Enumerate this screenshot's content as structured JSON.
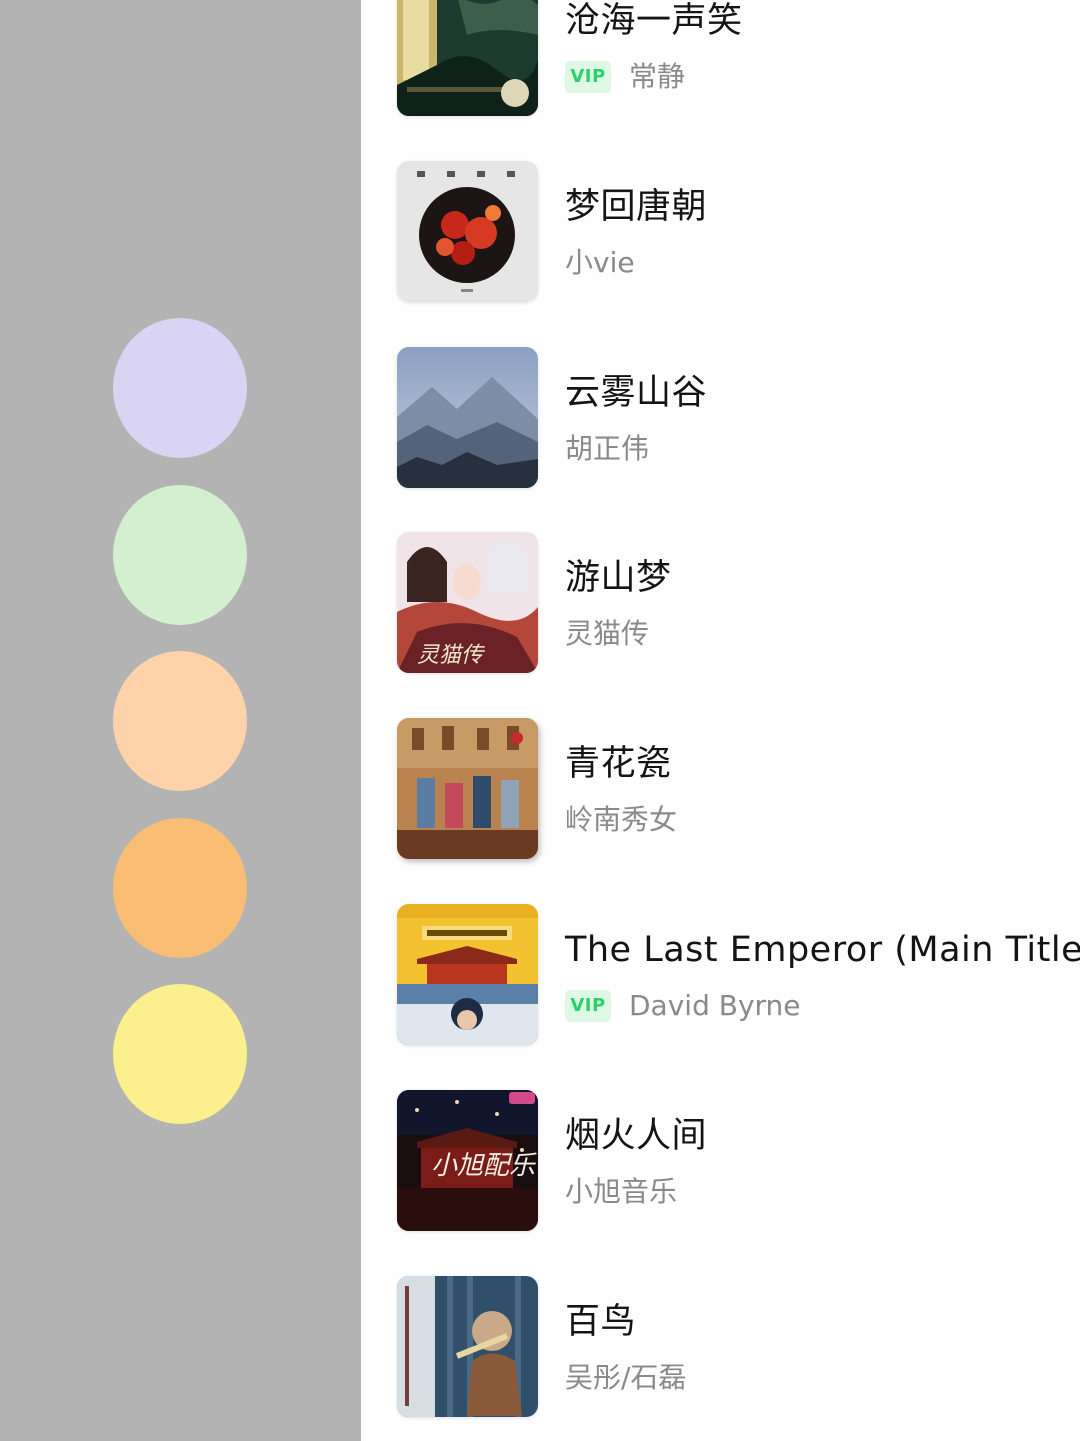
{
  "palette": {
    "swatches": [
      "#d9d3f4",
      "#d2f0cd",
      "#ffd3a9",
      "#f9bd73",
      "#fbf08d"
    ]
  },
  "songs": [
    {
      "title": "沧海一声笑",
      "artist": "常静",
      "vip": true,
      "vip_label": "VIP",
      "cover_icon": "album-cover-zhitan"
    },
    {
      "title": "梦回唐朝",
      "artist": "小vie",
      "vip": false,
      "cover_icon": "album-cover-menghui-tangchao"
    },
    {
      "title": "云雾山谷",
      "artist": "胡正伟",
      "vip": false,
      "cover_icon": "album-cover-misty-mountains"
    },
    {
      "title": "游山梦",
      "artist": "灵猫传",
      "vip": false,
      "cover_icon": "album-cover-lingmao-zhuan"
    },
    {
      "title": "青花瓷",
      "artist": "岭南秀女",
      "vip": false,
      "cover_icon": "album-cover-qinghuaci"
    },
    {
      "title": "The Last Emperor (Main Title T",
      "artist": "David Byrne",
      "vip": true,
      "vip_label": "VIP",
      "cover_icon": "album-cover-last-emperor"
    },
    {
      "title": "烟火人间",
      "artist": "小旭音乐",
      "vip": false,
      "cover_icon": "album-cover-xiaoxu-peiyue"
    },
    {
      "title": "百鸟",
      "artist": "吴彤/石磊",
      "vip": false,
      "cover_icon": "album-cover-bainiao"
    }
  ]
}
